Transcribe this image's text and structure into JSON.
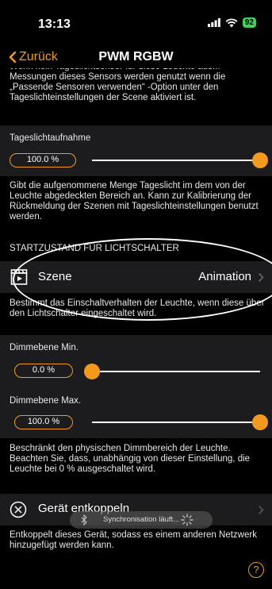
{
  "status_bar": {
    "time": "13:13",
    "battery": "92"
  },
  "nav": {
    "back_label": "Zurück",
    "title": "PWM RGBW"
  },
  "intro_text": "Wenn kein Tageslichtsensor für diese Leuchte aus... Messungen dieses Sensors werden genutzt wenn die „Passende Sensoren verwenden“ -Option unter den Tageslichteinstellungen der Scene aktiviert ist.",
  "daylight": {
    "label": "Tageslichtaufnahme",
    "value": "100.0 %",
    "level": 1.0,
    "description": "Gibt die aufgenommene Menge Tageslicht im dem von der Leuchte abgedeckten Bereich an. Kann zur Kalibrierung der Rückmeldung der Szenen mit Tageslichteinstellungen benutzt werden."
  },
  "start_state": {
    "header": "STARTZUSTAND FÜR LICHTSCHALTER",
    "row_label": "Szene",
    "row_value": "Animation",
    "description": "Bestimmt das Einschaltverhalten der Leuchte, wenn diese über den Lichtschalter eingeschaltet wird."
  },
  "dim_min": {
    "label": "Dimmebene Min.",
    "value": "0.0 %",
    "level": 0.0
  },
  "dim_max": {
    "label": "Dimmebene Max.",
    "value": "100.0 %",
    "level": 1.0
  },
  "dim_description": "Beschränkt den physischen Dimmbereich der Leuchte. Beachten Sie, dass, unabhängig von dieser Einstellung, die Leuchte bei 0 % ausgeschaltet wird.",
  "unpair": {
    "label": "Gerät entkoppeln",
    "description": "Entkoppelt dieses Gerät, sodass es einem anderen Netzwerk hinzugefügt werden kann."
  },
  "toast": {
    "text": "Synchronisation läuft..."
  },
  "help": {
    "symbol": "?"
  },
  "colors": {
    "accent": "#f39a1e",
    "background": "#000000",
    "group": "#1c1c1e"
  }
}
